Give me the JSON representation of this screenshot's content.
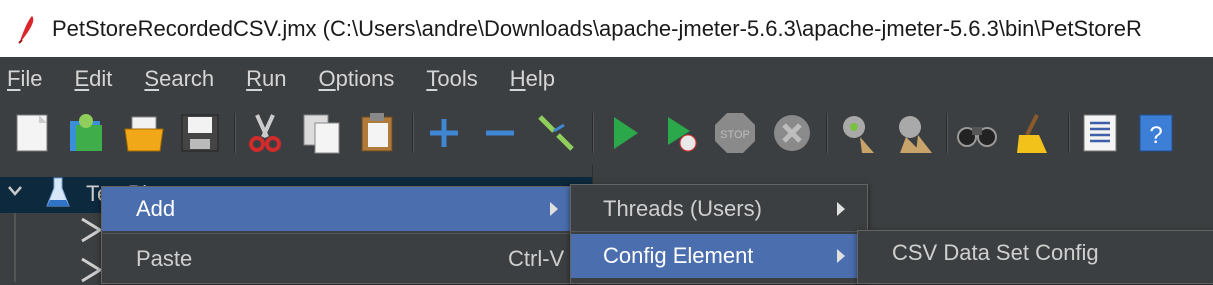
{
  "window": {
    "title": "PetStoreRecordedCSV.jmx (C:\\Users\\andre\\Downloads\\apache-jmeter-5.6.3\\apache-jmeter-5.6.3\\bin\\PetStoreR"
  },
  "menubar": {
    "items": [
      {
        "mnemonic": "F",
        "rest": "ile"
      },
      {
        "mnemonic": "E",
        "rest": "dit"
      },
      {
        "mnemonic": "S",
        "rest": "earch"
      },
      {
        "mnemonic": "R",
        "rest": "un"
      },
      {
        "mnemonic": "O",
        "rest": "ptions"
      },
      {
        "mnemonic": "T",
        "rest": "ools"
      },
      {
        "mnemonic": "H",
        "rest": "elp"
      }
    ]
  },
  "toolbar": {
    "icons": [
      "new-icon",
      "templates-icon",
      "open-icon",
      "save-icon",
      "cut-icon",
      "copy-icon",
      "paste-icon",
      "expand-icon",
      "collapse-icon",
      "toggle-icon",
      "start-icon",
      "start-no-pauses-icon",
      "stop-icon",
      "shutdown-icon",
      "clear-icon",
      "clear-all-icon",
      "search-icon",
      "reset-search-icon",
      "function-helper-icon",
      "help-icon"
    ],
    "stop_label": "STOP"
  },
  "tree": {
    "root_label": "Te   Pl"
  },
  "context_menu": {
    "items": [
      {
        "label": "Add",
        "shortcut": ""
      },
      {
        "label": "Paste",
        "shortcut": "Ctrl-V"
      }
    ]
  },
  "add_submenu": {
    "items": [
      {
        "label": "Threads (Users)"
      },
      {
        "label": "Config Element"
      }
    ]
  },
  "config_submenu": {
    "items": [
      {
        "label": "CSV Data Set Config"
      }
    ]
  },
  "colors": {
    "background": "#3c3f41",
    "selection": "#4b6eaf",
    "tree_selection": "#0d293e"
  }
}
